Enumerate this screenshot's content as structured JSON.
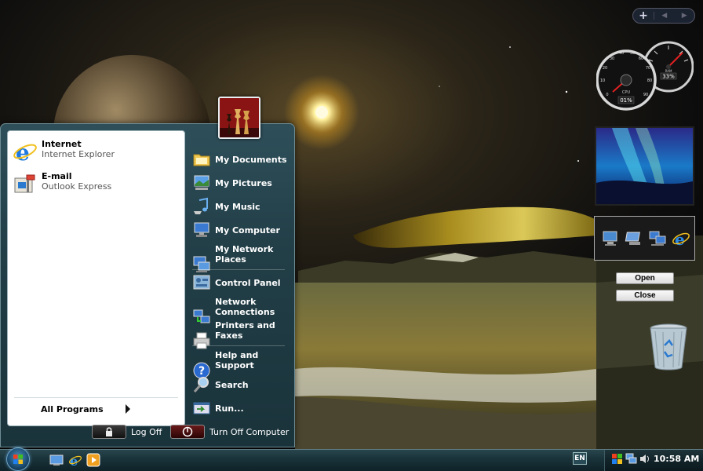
{
  "start_menu": {
    "pinned": [
      {
        "title": "Internet",
        "subtitle": "Internet Explorer",
        "icon": "internet-explorer-icon"
      },
      {
        "title": "E-mail",
        "subtitle": "Outlook Express",
        "icon": "outlook-express-icon"
      }
    ],
    "all_programs_label": "All Programs",
    "right_items": [
      {
        "label": "My Documents",
        "icon": "folder-documents-icon"
      },
      {
        "label": "My Pictures",
        "icon": "pictures-icon"
      },
      {
        "label": "My Music",
        "icon": "music-icon"
      },
      {
        "label": "My Computer",
        "icon": "computer-icon"
      },
      {
        "label": "My Network\nPlaces",
        "icon": "network-places-icon"
      },
      {
        "label": "Control Panel",
        "icon": "control-panel-icon"
      },
      {
        "label": "Network\nConnections",
        "icon": "network-connections-icon"
      },
      {
        "label": "Printers and\nFaxes",
        "icon": "printer-icon"
      },
      {
        "label": "Help and\nSupport",
        "icon": "help-icon"
      },
      {
        "label": "Search",
        "icon": "search-icon"
      },
      {
        "label": "Run...",
        "icon": "run-icon"
      }
    ],
    "log_off_label": "Log Off",
    "turn_off_label": "Turn Off Computer",
    "user_picture": "chess-pieces-avatar"
  },
  "taskbar": {
    "language": "EN",
    "clock": "10:58 AM",
    "quick_launch": [
      "show-desktop-icon",
      "internet-explorer-icon",
      "media-player-icon"
    ],
    "tray_icons": [
      "windows-flag-icon",
      "network-tray-icon",
      "volume-icon"
    ]
  },
  "gadgets": {
    "cpu_label": "CPU",
    "cpu_value": "01%",
    "ram_label": "RAM",
    "ram_value": "33%",
    "open_label": "Open",
    "close_label": "Close",
    "shortcut_icons": [
      "computer-icon",
      "network-icon",
      "network-connections-icon",
      "internet-explorer-icon"
    ]
  },
  "colors": {
    "menu_bg": "#223e47",
    "taskbar_bg": "#183037",
    "accent": "#4a8fbf"
  }
}
